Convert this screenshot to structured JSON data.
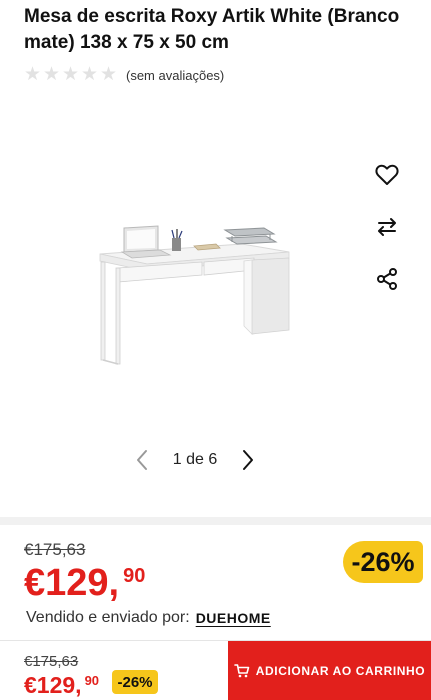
{
  "product": {
    "title": "Mesa de escrita Roxy Artik White (Branco mate) 138 x 75 x 50 cm",
    "rating": {
      "stars_filled": 0,
      "stars_total": 5,
      "text": "(sem avaliações)"
    }
  },
  "gallery": {
    "pager_text": "1 de 6"
  },
  "side_actions": [
    {
      "icon": "heart-icon"
    },
    {
      "icon": "compare-arrows-icon"
    },
    {
      "icon": "share-icon"
    }
  ],
  "pricing": {
    "old_price": "€175,63",
    "new_price_int": "€129,",
    "new_price_cents": "90",
    "discount": "-26%"
  },
  "seller": {
    "label": "Vendido e enviado por:",
    "name": "DUEHOME"
  },
  "bottom_bar": {
    "old_price": "€175,63",
    "new_price_int": "€129,",
    "new_price_cents": "90",
    "discount": "-26%",
    "cart_label": "ADICIONAR AO CARRINHO"
  },
  "colors": {
    "price_red": "#e2201c",
    "badge_yellow": "#f6c61b",
    "star_gray": "#e2e2e2"
  }
}
